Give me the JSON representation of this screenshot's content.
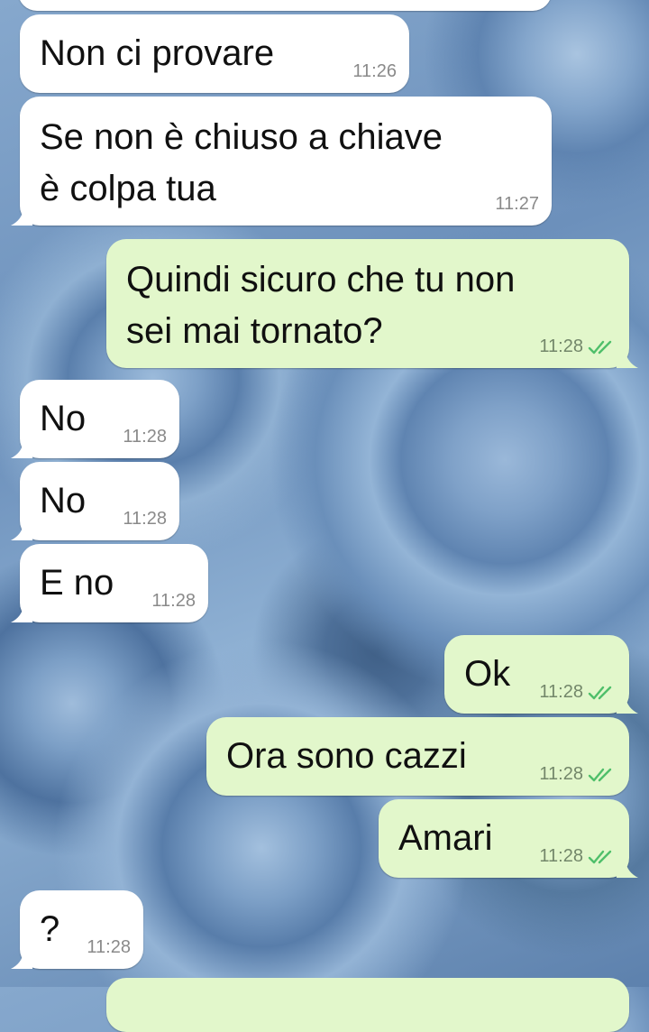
{
  "messages": [
    {
      "direction": "in",
      "text": "Non ci provare",
      "time": "11:26"
    },
    {
      "direction": "in",
      "text": "Se non è chiuso a chiave\nè colpa tua",
      "time": "11:27"
    },
    {
      "direction": "out",
      "text": "Quindi sicuro che tu non\nsei mai tornato?",
      "time": "11:28",
      "status_icon": "double-check-icon"
    },
    {
      "direction": "in",
      "text": "No",
      "time": "11:28"
    },
    {
      "direction": "in",
      "text": "No",
      "time": "11:28"
    },
    {
      "direction": "in",
      "text": "E no",
      "time": "11:28"
    },
    {
      "direction": "out",
      "text": "Ok",
      "time": "11:28",
      "status_icon": "double-check-icon"
    },
    {
      "direction": "out",
      "text": "Ora sono cazzi",
      "time": "11:28",
      "status_icon": "double-check-icon"
    },
    {
      "direction": "out",
      "text": "Amari",
      "time": "11:28",
      "status_icon": "double-check-icon"
    },
    {
      "direction": "in",
      "text": "?",
      "time": "11:28"
    }
  ],
  "colors": {
    "incoming_bubble": "#ffffff",
    "outgoing_bubble": "#e2f7cb",
    "read_tick": "#4fbf6a",
    "wallpaper": "#6f93bd"
  }
}
